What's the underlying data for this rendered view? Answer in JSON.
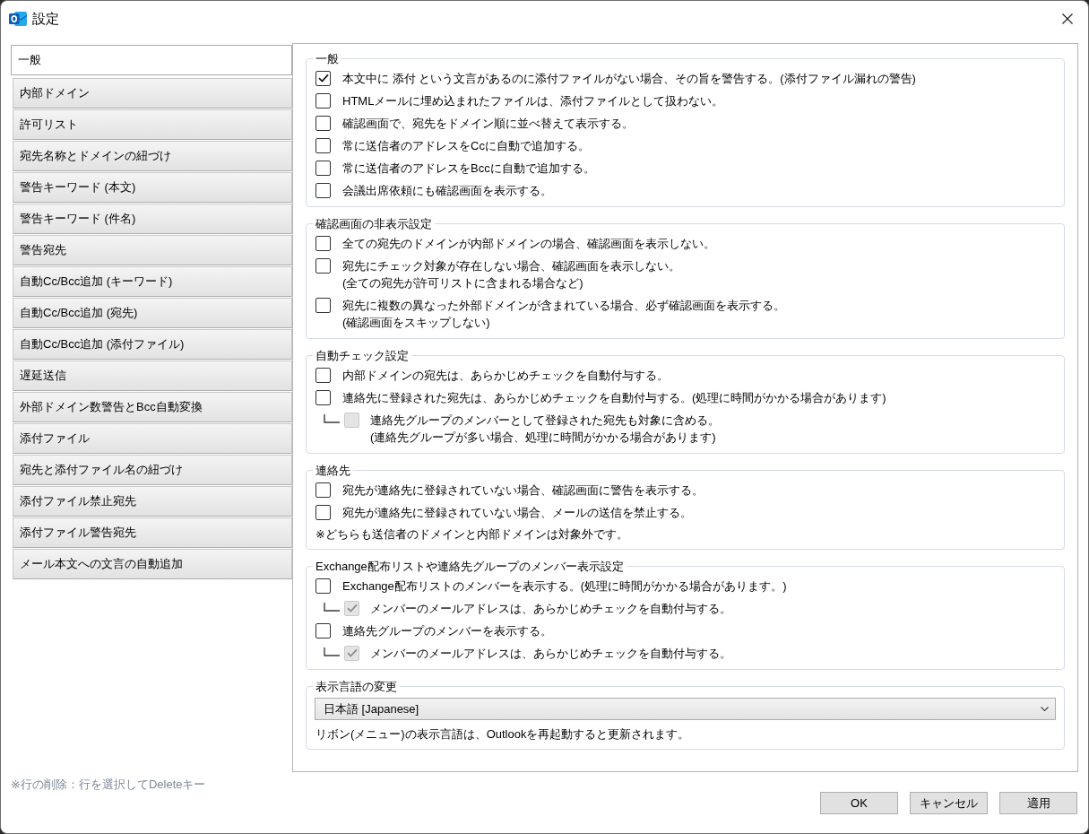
{
  "window": {
    "title": "設定"
  },
  "sidebar": {
    "items": [
      {
        "label": "一般",
        "selected": true
      },
      {
        "label": "内部ドメイン",
        "selected": false
      },
      {
        "label": "許可リスト",
        "selected": false
      },
      {
        "label": "宛先名称とドメインの紐づけ",
        "selected": false
      },
      {
        "label": "警告キーワード (本文)",
        "selected": false
      },
      {
        "label": "警告キーワード (件名)",
        "selected": false
      },
      {
        "label": "警告宛先",
        "selected": false
      },
      {
        "label": "自動Cc/Bcc追加 (キーワード)",
        "selected": false
      },
      {
        "label": "自動Cc/Bcc追加 (宛先)",
        "selected": false
      },
      {
        "label": "自動Cc/Bcc追加 (添付ファイル)",
        "selected": false
      },
      {
        "label": "遅延送信",
        "selected": false
      },
      {
        "label": "外部ドメイン数警告とBcc自動変換",
        "selected": false
      },
      {
        "label": "添付ファイル",
        "selected": false
      },
      {
        "label": "宛先と添付ファイル名の紐づけ",
        "selected": false
      },
      {
        "label": "添付ファイル禁止宛先",
        "selected": false
      },
      {
        "label": "添付ファイル警告宛先",
        "selected": false
      },
      {
        "label": "メール本文への文言の自動追加",
        "selected": false
      }
    ]
  },
  "groups": [
    {
      "title": "一般",
      "items": [
        {
          "kind": "checkbox",
          "label": "本文中に 添付 という文言があるのに添付ファイルがない場合、その旨を警告する。(添付ファイル漏れの警告)",
          "checked": true,
          "disabled": false
        },
        {
          "kind": "checkbox",
          "label": "HTMLメールに埋め込まれたファイルは、添付ファイルとして扱わない。",
          "checked": false,
          "disabled": false
        },
        {
          "kind": "checkbox",
          "label": "確認画面で、宛先をドメイン順に並べ替えて表示する。",
          "checked": false,
          "disabled": false
        },
        {
          "kind": "checkbox",
          "label": "常に送信者のアドレスをCcに自動で追加する。",
          "checked": false,
          "disabled": false
        },
        {
          "kind": "checkbox",
          "label": "常に送信者のアドレスをBccに自動で追加する。",
          "checked": false,
          "disabled": false
        },
        {
          "kind": "checkbox",
          "label": "会議出席依頼にも確認画面を表示する。",
          "checked": false,
          "disabled": false
        }
      ]
    },
    {
      "title": "確認画面の非表示設定",
      "items": [
        {
          "kind": "checkbox",
          "label": "全ての宛先のドメインが内部ドメインの場合、確認画面を表示しない。",
          "checked": false,
          "disabled": false
        },
        {
          "kind": "checkbox",
          "label": "宛先にチェック対象が存在しない場合、確認画面を表示しない。",
          "detail": "(全ての宛先が許可リストに含まれる場合など)",
          "checked": false,
          "disabled": false
        },
        {
          "kind": "checkbox",
          "label": "宛先に複数の異なった外部ドメインが含まれている場合、必ず確認画面を表示する。",
          "detail": "(確認画面をスキップしない)",
          "checked": false,
          "disabled": false
        }
      ]
    },
    {
      "title": "自動チェック設定",
      "items": [
        {
          "kind": "checkbox",
          "label": "内部ドメインの宛先は、あらかじめチェックを自動付与する。",
          "checked": false,
          "disabled": false
        },
        {
          "kind": "checkbox",
          "label": "連絡先に登録された宛先は、あらかじめチェックを自動付与する。(処理に時間がかかる場合があります)",
          "checked": false,
          "disabled": false,
          "children": [
            {
              "kind": "checkbox",
              "label": "連絡先グループのメンバーとして登録された宛先も対象に含める。",
              "detail": "(連絡先グループが多い場合、処理に時間がかかる場合があります)",
              "checked": false,
              "disabled": true
            }
          ]
        }
      ]
    },
    {
      "title": "連絡先",
      "items": [
        {
          "kind": "checkbox",
          "label": "宛先が連絡先に登録されていない場合、確認画面に警告を表示する。",
          "checked": false,
          "disabled": false
        },
        {
          "kind": "checkbox",
          "label": "宛先が連絡先に登録されていない場合、メールの送信を禁止する。",
          "checked": false,
          "disabled": false
        },
        {
          "kind": "note",
          "text": "※どちらも送信者のドメインと内部ドメインは対象外です。"
        }
      ]
    },
    {
      "title": "Exchange配布リストや連絡先グループのメンバー表示設定",
      "items": [
        {
          "kind": "checkbox",
          "label": "Exchange配布リストのメンバーを表示する。(処理に時間がかかる場合があります。)",
          "checked": false,
          "disabled": false,
          "children": [
            {
              "kind": "checkbox",
              "label": "メンバーのメールアドレスは、あらかじめチェックを自動付与する。",
              "checked": true,
              "disabled": true
            }
          ]
        },
        {
          "kind": "checkbox",
          "label": "連絡先グループのメンバーを表示する。",
          "checked": false,
          "disabled": false,
          "children": [
            {
              "kind": "checkbox",
              "label": "メンバーのメールアドレスは、あらかじめチェックを自動付与する。",
              "checked": true,
              "disabled": true
            }
          ]
        }
      ]
    },
    {
      "title": "表示言語の変更",
      "items": [
        {
          "kind": "select",
          "value": "日本語 [Japanese]"
        },
        {
          "kind": "note",
          "text": "リボン(メニュー)の表示言語は、Outlookを再起動すると更新されます。"
        }
      ]
    }
  ],
  "hint": "※行の削除：行を選択してDeleteキー",
  "buttons": [
    {
      "label": "OK"
    },
    {
      "label": "キャンセル"
    },
    {
      "label": "適用"
    }
  ]
}
